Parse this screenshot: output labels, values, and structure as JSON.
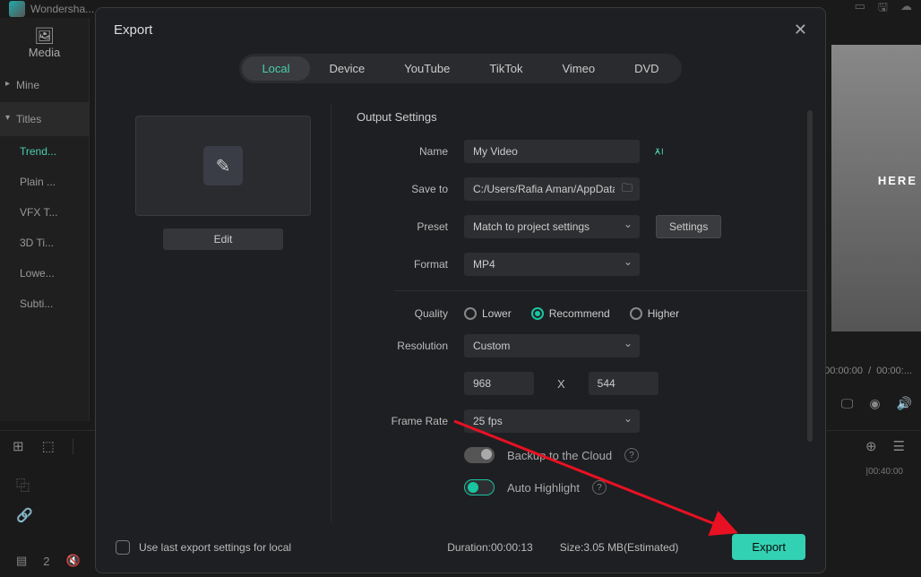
{
  "app": {
    "brand": "Wondersha..."
  },
  "sidebar": {
    "media_tab": "Media",
    "items": [
      "Mine",
      "Titles"
    ],
    "sub_items": [
      "Trend...",
      "Plain ...",
      "VFX T...",
      "3D Ti...",
      "Lowe...",
      "Subti..."
    ]
  },
  "preview": {
    "overlay_text": "HERE"
  },
  "timecode": {
    "current": "00:00:00",
    "total": "00:00:..."
  },
  "timeline": {
    "ruler_tick": "00:40:00",
    "count_badge": "2"
  },
  "modal": {
    "title": "Export",
    "tabs": [
      "Local",
      "Device",
      "YouTube",
      "TikTok",
      "Vimeo",
      "DVD"
    ],
    "edit_btn": "Edit",
    "section_title": "Output Settings",
    "labels": {
      "name": "Name",
      "saveto": "Save to",
      "preset": "Preset",
      "format": "Format",
      "quality": "Quality",
      "resolution": "Resolution",
      "framerate": "Frame Rate",
      "backup": "Backup to the Cloud",
      "autohl": "Auto Highlight"
    },
    "values": {
      "name": "My Video",
      "saveto": "C:/Users/Rafia Aman/AppData...",
      "preset": "Match to project settings",
      "format": "MP4",
      "resolution": "Custom",
      "res_w": "968",
      "res_x": "X",
      "res_h": "544",
      "framerate": "25 fps",
      "settings_btn": "Settings"
    },
    "quality_options": {
      "lower": "Lower",
      "recommend": "Recommend",
      "higher": "Higher"
    },
    "footer": {
      "uselast": "Use last export settings for local",
      "duration_label": "Duration:",
      "duration_val": "00:00:13",
      "size_label": "Size:",
      "size_val": "3.05 MB(Estimated)",
      "export_btn": "Export"
    }
  }
}
